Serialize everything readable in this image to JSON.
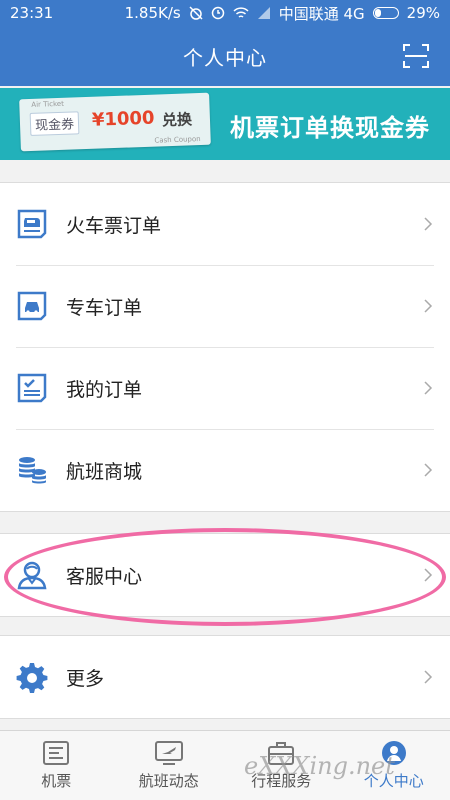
{
  "status": {
    "time": "23:31",
    "speed": "1.85K/s",
    "carrier": "中国联通 4G",
    "battery": "29%",
    "battery_level": 0.29
  },
  "header": {
    "title": "个人中心"
  },
  "banner": {
    "ticket_small": "Air Ticket",
    "ticket_tag": "现金券",
    "ticket_amount": "¥1000",
    "ticket_exchange": "兑换",
    "ticket_footer": "Cash Coupon",
    "headline": "机票订单换现金券"
  },
  "menu": {
    "items": [
      {
        "label": "火车票订单",
        "icon": "train-ticket-icon"
      },
      {
        "label": "专车订单",
        "icon": "car-icon"
      },
      {
        "label": "我的订单",
        "icon": "order-list-icon"
      },
      {
        "label": "航班商城",
        "icon": "coins-icon"
      }
    ],
    "service": {
      "label": "客服中心",
      "icon": "customer-service-icon"
    },
    "more": {
      "label": "更多",
      "icon": "gear-icon"
    }
  },
  "tabs": [
    {
      "label": "机票",
      "icon": "ticket-icon"
    },
    {
      "label": "航班动态",
      "icon": "flight-board-icon"
    },
    {
      "label": "行程服务",
      "icon": "suitcase-icon"
    },
    {
      "label": "个人中心",
      "icon": "person-icon",
      "active": true
    }
  ],
  "watermark": "eXXXing.net",
  "colors": {
    "primary": "#3d7ac9",
    "banner": "#22b1ba",
    "highlight": "#f06ba5"
  }
}
